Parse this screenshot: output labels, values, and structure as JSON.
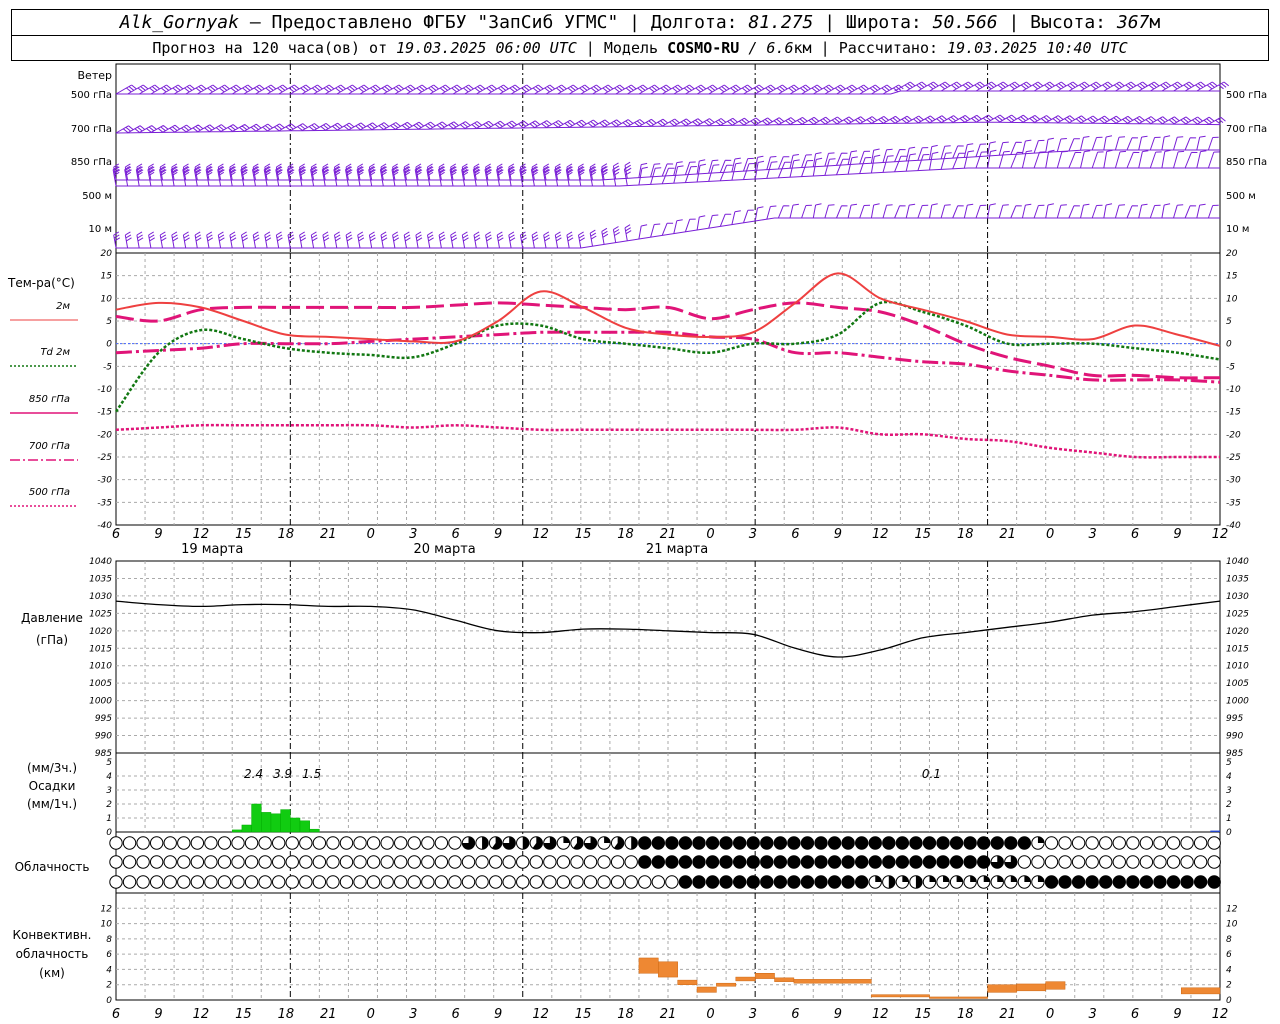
{
  "header": {
    "station": "Alk_Gornyak",
    "dash": "–",
    "provider": "Предоставлено ФГБУ \"ЗапСиб УГМС\"",
    "lon_label": "Долгота:",
    "lon_value": "81.275",
    "lat_label": "Широта:",
    "lat_value": "50.566",
    "alt_label": "Высота:",
    "alt_value": "367",
    "alt_unit": "м",
    "forecast_label": "Прогноз на 120 часа(ов) от",
    "forecast_start": "19.03.2025 06:00 UTC",
    "model_label": "Модель",
    "model_name": "COSMO-RU",
    "model_res": "/ 6.6",
    "model_res_unit": "км",
    "calc_label": "Рассчитано:",
    "calc_time": "19.03.2025 10:40 UTC"
  },
  "colors": {
    "wind": "#7a1fd6",
    "t2m": "#ee4040",
    "td2m": "#117711",
    "t850": "#e01478",
    "t700": "#e01478",
    "t500": "#e01478",
    "zero_line": "#4466ff",
    "precip": "#11cc11",
    "conv": "#ee8833",
    "grid": "#aaaaaa"
  },
  "time_axis": {
    "ticks": [
      "6",
      "9",
      "12",
      "15",
      "18",
      "21",
      "0",
      "3",
      "6",
      "9",
      "12",
      "15",
      "18",
      "21",
      "0",
      "3",
      "6",
      "9",
      "12",
      "15",
      "18",
      "21",
      "0",
      "3",
      "6",
      "9",
      "12"
    ],
    "day_labels": [
      "19 марта",
      "20 марта",
      "21 марта"
    ]
  },
  "chart_data": [
    {
      "type": "barbs",
      "title": "Ветер",
      "levels": [
        "500 гПа",
        "700 гПа",
        "850 гПа",
        "500 м",
        "10 м"
      ]
    },
    {
      "type": "line",
      "title": "Тем-ра(°C)",
      "ylim": [
        -40,
        20
      ],
      "yticks": [
        "20",
        "15",
        "10",
        "5",
        "0",
        "-5",
        "-10",
        "-15",
        "-20",
        "-25",
        "-30",
        "-35",
        "-40"
      ],
      "series": [
        {
          "name": "2м",
          "values": [
            7.5,
            9,
            8,
            5,
            2,
            1.5,
            1,
            0.5,
            0.5,
            5,
            11.5,
            8,
            3.5,
            2,
            1.5,
            2.5,
            9,
            15.5,
            10,
            7.5,
            5,
            2,
            1.5,
            1,
            4,
            2,
            -0.5
          ]
        },
        {
          "name": "Td 2м",
          "values": [
            -15,
            -2,
            3,
            1,
            -1,
            -2,
            -2.5,
            -3,
            0,
            4,
            4,
            1,
            0,
            -1,
            -2,
            0,
            0,
            2,
            9,
            7,
            4,
            0,
            0,
            0,
            -1,
            -2,
            -3.5
          ]
        },
        {
          "name": "850 гПа",
          "values": [
            6,
            5,
            7.5,
            8,
            8,
            8,
            8,
            8,
            8.5,
            9,
            8.5,
            8,
            7.5,
            8,
            5.5,
            7.5,
            9,
            8,
            7,
            4,
            0,
            -3,
            -5,
            -7,
            -7,
            -7.5,
            -7.5
          ]
        },
        {
          "name": "700 гПа",
          "values": [
            -2,
            -1.5,
            -1,
            0,
            0,
            0,
            0.5,
            1,
            1.5,
            2,
            2.5,
            2.5,
            2.5,
            2.5,
            1.5,
            1,
            -2,
            -2,
            -3,
            -4,
            -4.5,
            -6,
            -7,
            -8,
            -8,
            -8,
            -8.5
          ]
        },
        {
          "name": "500 гПа",
          "values": [
            -19,
            -18.5,
            -18,
            -18,
            -18,
            -18,
            -18,
            -18.5,
            -18,
            -18.5,
            -19,
            -19,
            -19,
            -19,
            -19,
            -19,
            -19,
            -18.5,
            -20,
            -20,
            -21,
            -21.5,
            -23,
            -24,
            -25,
            -25,
            -25
          ]
        }
      ]
    },
    {
      "type": "line",
      "title": "Давление",
      "ylabel": "(гПа)",
      "ylim": [
        985,
        1040
      ],
      "yticks": [
        "1040",
        "1035",
        "1030",
        "1025",
        "1020",
        "1015",
        "1010",
        "1005",
        "1000",
        "995",
        "990",
        "985"
      ],
      "series": [
        {
          "name": "",
          "values": [
            1028.5,
            1027.5,
            1027,
            1027.5,
            1027.5,
            1027,
            1027,
            1026,
            1023,
            1020,
            1019.5,
            1020.5,
            1020.5,
            1020,
            1019.5,
            1019,
            1015,
            1012.5,
            1014.5,
            1018,
            1019.5,
            1021,
            1022.5,
            1024.5,
            1025.5,
            1027,
            1028.5
          ]
        }
      ]
    },
    {
      "type": "bar",
      "title": "Осадки",
      "ylabel_top": "(мм/3ч.)",
      "ylabel_bottom": "(мм/1ч.)",
      "ylim": [
        0,
        5
      ],
      "yticks": [
        "5",
        "4",
        "3",
        "2",
        "1",
        "0"
      ],
      "hourly_bars": [
        {
          "h": 12,
          "v": 0.15
        },
        {
          "h": 13,
          "v": 0.5
        },
        {
          "h": 14,
          "v": 2.0
        },
        {
          "h": 15,
          "v": 1.4
        },
        {
          "h": 16,
          "v": 1.3
        },
        {
          "h": 17,
          "v": 1.6
        },
        {
          "h": 18,
          "v": 1.0
        },
        {
          "h": 19,
          "v": 0.8
        },
        {
          "h": 20,
          "v": 0.2
        }
      ],
      "accum_labels": [
        {
          "h": 14,
          "text": "2.4"
        },
        {
          "h": 17,
          "text": "3.9"
        },
        {
          "h": 20,
          "text": "1.5"
        },
        {
          "h": 84,
          "text": "0.1"
        }
      ]
    },
    {
      "type": "symbols",
      "title": "Облачность"
    },
    {
      "type": "bar",
      "title_lines": [
        "Конвективн.",
        "облачность",
        "(км)"
      ],
      "ylim": [
        0,
        13
      ],
      "yticks": [
        "12",
        "10",
        "8",
        "6",
        "4",
        "2",
        "0"
      ],
      "bars": [
        {
          "h0": 54,
          "h1": 56,
          "lo": 3.5,
          "hi": 5.5
        },
        {
          "h0": 56,
          "h1": 58,
          "lo": 3,
          "hi": 5
        },
        {
          "h0": 58,
          "h1": 60,
          "lo": 2,
          "hi": 2.6
        },
        {
          "h0": 60,
          "h1": 62,
          "lo": 1,
          "hi": 1.7
        },
        {
          "h0": 62,
          "h1": 64,
          "lo": 1.8,
          "hi": 2.2
        },
        {
          "h0": 64,
          "h1": 66,
          "lo": 2.5,
          "hi": 3
        },
        {
          "h0": 66,
          "h1": 68,
          "lo": 2.8,
          "hi": 3.5
        },
        {
          "h0": 68,
          "h1": 70,
          "lo": 2.4,
          "hi": 2.9
        },
        {
          "h0": 70,
          "h1": 78,
          "lo": 2.2,
          "hi": 2.7
        },
        {
          "h0": 78,
          "h1": 84,
          "lo": 0.4,
          "hi": 0.7
        },
        {
          "h0": 84,
          "h1": 90,
          "lo": 0.2,
          "hi": 0.4
        },
        {
          "h0": 90,
          "h1": 93,
          "lo": 1.0,
          "hi": 2.0
        },
        {
          "h0": 93,
          "h1": 96,
          "lo": 1.2,
          "hi": 2.1
        },
        {
          "h0": 96,
          "h1": 98,
          "lo": 1.4,
          "hi": 2.4
        },
        {
          "h0": 110,
          "h1": 114,
          "lo": 0.8,
          "hi": 1.6
        }
      ]
    }
  ]
}
